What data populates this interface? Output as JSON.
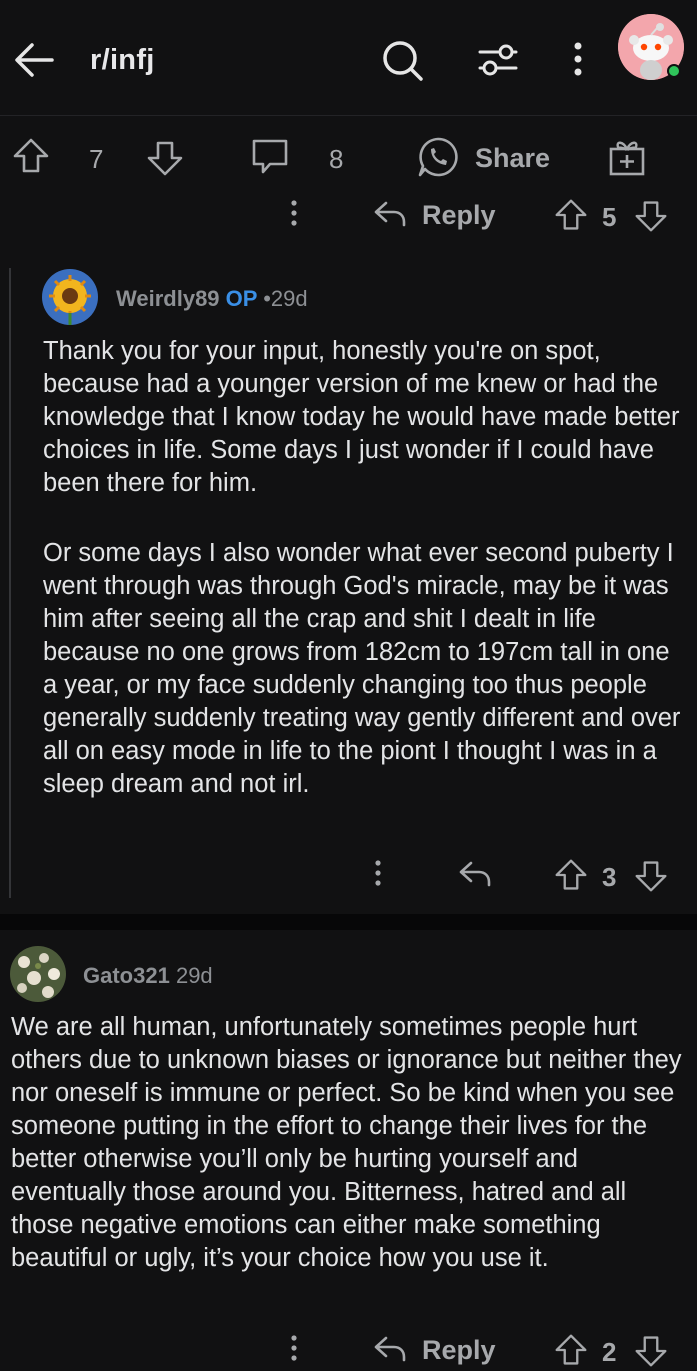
{
  "header": {
    "subreddit": "r/infj",
    "icons": [
      "back-arrow-icon",
      "search-icon",
      "filter-icon",
      "more-vertical-icon",
      "user-avatar"
    ]
  },
  "post_actions": {
    "upvotes": "7",
    "comments": "8",
    "share_label": "Share"
  },
  "parent_comment_actions": {
    "reply_label": "Reply",
    "votes": "5"
  },
  "comments": [
    {
      "username": "Weirdly89",
      "op_badge": "OP",
      "separator": "•",
      "time": "29d",
      "paragraph1": "Thank you for your input, honestly you're on spot, because had a younger version of me knew or had the knowledge that I know today he would have made better choices in life. Some days I just wonder if I could have been there for him.",
      "paragraph2": "Or some days I also wonder what ever second puberty I went through was through God's miracle, may be it was him after seeing all the crap and shit I dealt in life because no one grows from 182cm to 197cm tall in one a year, or my face suddenly changing too thus people generally suddenly treating way gently different and over all on easy mode in life to the piont I thought I was in a sleep dream and not irl.",
      "votes": "3"
    },
    {
      "username": "Gato321",
      "time": "29d",
      "body": "We are all human, unfortunately sometimes people hurt others due to unknown biases or ignorance but neither they nor oneself is immune or perfect. So be kind when you see someone putting in the effort to change their lives for the better otherwise you’ll only be hurting yourself and eventually those around you. Bitterness, hatred and all those negative emotions can either make something beautiful or ugly, it’s your choice how you use it.",
      "reply_label": "Reply",
      "votes": "2"
    }
  ],
  "colors": {
    "background": "#111112",
    "text": "#e3e4e6",
    "muted": "#a7a9ac",
    "op_blue": "#3a8fe6",
    "online_green": "#2fc45a"
  }
}
